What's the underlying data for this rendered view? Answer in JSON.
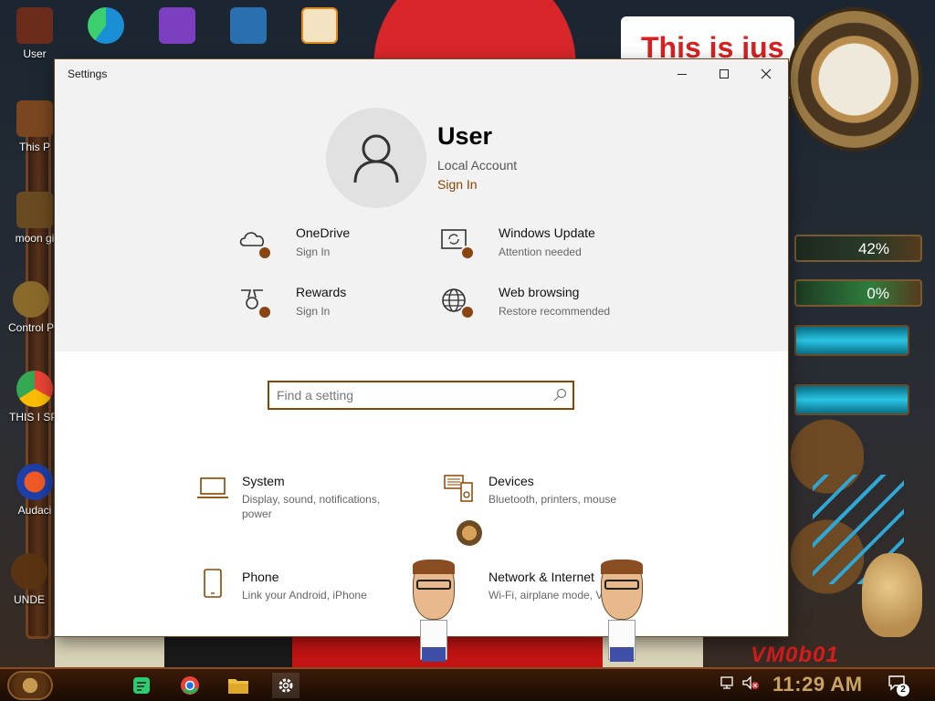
{
  "desktop": {
    "banner_text": "This is jus",
    "gauges": [
      "42%",
      "0%"
    ],
    "vm_logo": "VM0b01",
    "icons": [
      {
        "label": "User",
        "color": "#6a2b1a"
      },
      {
        "label": "This P",
        "color": "#7a4620"
      },
      {
        "label": "moon gi",
        "color": "#6a4a20"
      },
      {
        "label": "Control P",
        "color": "#8a6a2a"
      },
      {
        "label": "THIS I SPYWA",
        "color": "#1a73e8"
      },
      {
        "label": "Audaci",
        "color": "#1e3fa8"
      },
      {
        "label": "UNDE",
        "color": "#5a3412"
      }
    ],
    "top_icons": [
      {
        "name": "edge",
        "color": "#1a8fd6"
      },
      {
        "name": "visual-studio",
        "color": "#7b3fbf"
      },
      {
        "name": "virtualbox",
        "color": "#2a6fb0"
      },
      {
        "name": "hxd",
        "color": "#e08a1e"
      }
    ]
  },
  "window": {
    "title": "Settings",
    "minimize": "—",
    "maximize": "☐",
    "close": "✕"
  },
  "account": {
    "name": "User",
    "type": "Local Account",
    "sign_in": "Sign In"
  },
  "quick_links": [
    {
      "title": "OneDrive",
      "subtitle": "Sign In",
      "icon": "cloud-icon"
    },
    {
      "title": "Windows Update",
      "subtitle": "Attention needed",
      "icon": "update-icon"
    },
    {
      "title": "Rewards",
      "subtitle": "Sign In",
      "icon": "medal-icon"
    },
    {
      "title": "Web browsing",
      "subtitle": "Restore recommended",
      "icon": "globe-icon"
    }
  ],
  "search": {
    "placeholder": "Find a setting"
  },
  "categories": [
    {
      "title": "System",
      "subtitle": "Display, sound, notifications, power",
      "icon": "laptop-icon"
    },
    {
      "title": "Devices",
      "subtitle": "Bluetooth, printers, mouse",
      "icon": "keyboard-speaker-icon"
    },
    {
      "title": "Phone",
      "subtitle": "Link your Android, iPhone",
      "icon": "phone-icon"
    },
    {
      "title": "Network & Internet",
      "subtitle": "Wi-Fi, airplane mode, VPN",
      "icon": "globe-icon"
    }
  ],
  "taskbar": {
    "apps": [
      {
        "name": "notes-app",
        "color": "#2ecc71"
      },
      {
        "name": "chrome",
        "color": "#1a73e8"
      },
      {
        "name": "file-explorer",
        "color": "#f0c040"
      },
      {
        "name": "settings",
        "color": "#ffffff"
      }
    ],
    "time": "11:29 AM",
    "notification_count": "2"
  },
  "colors": {
    "accent": "#8a4500",
    "status_dot": "#8b4513",
    "header_bg": "#f2f2f2"
  }
}
